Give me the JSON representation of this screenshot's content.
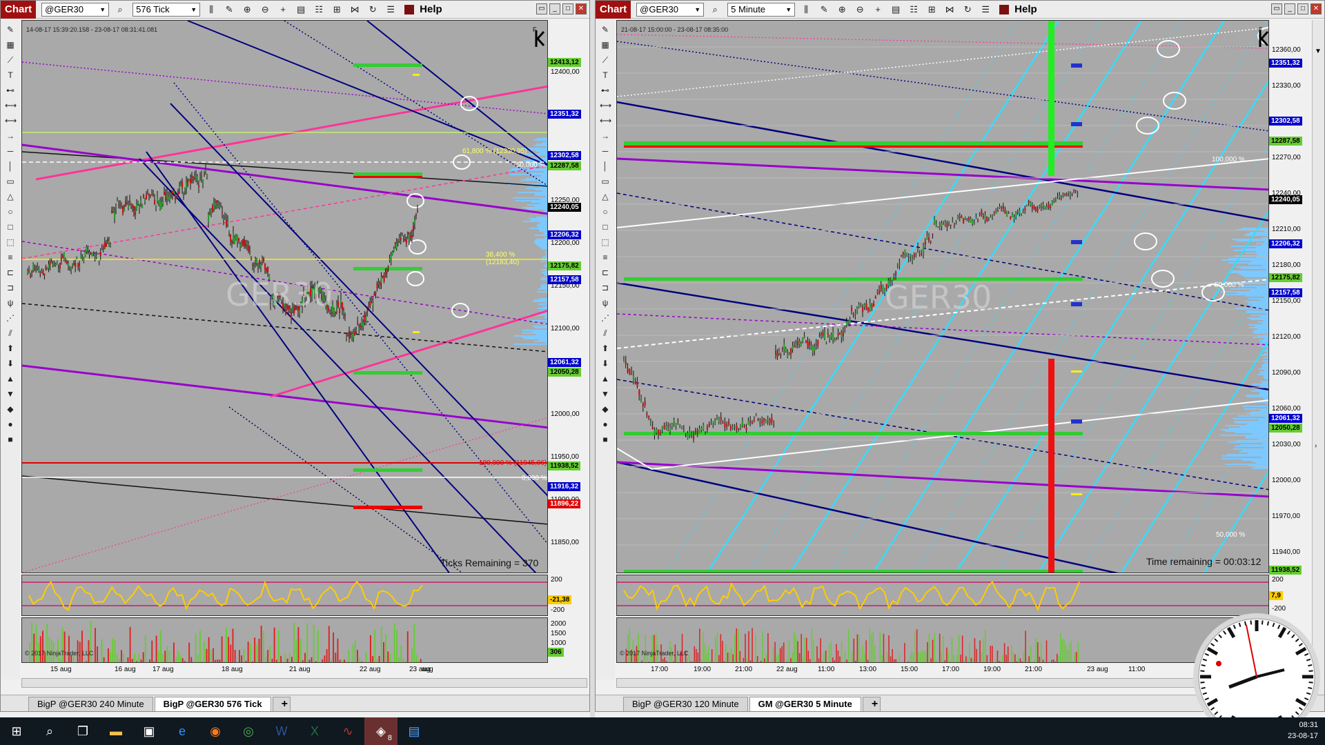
{
  "colors": {
    "chart_bg": "#a9a9a9",
    "accent_red": "#a01010",
    "price_label_blue": "#0000cc",
    "price_label_green": "#66cc33",
    "price_label_red": "#dd0000",
    "current_price_black": "#000000",
    "line_magenta": "#ff3399",
    "line_purple": "#9900cc",
    "line_navy": "#000080",
    "line_cyan": "#33ddff",
    "oscillator_yellow": "#ffcc00",
    "volume_green": "#66cc33",
    "volume_red": "#dd2222"
  },
  "left": {
    "toolbar": {
      "chart_label": "Chart",
      "instrument": "@GER30",
      "interval": "576 Tick",
      "help": "Help"
    },
    "info_text": "14-08-17 15:39:20.158 - 23-08-17 08:31:41.081",
    "watermark": "GER30",
    "ticks_remaining": "Ticks Remaining = 370",
    "copyright": "© 2017 NinjaTrader, LLC",
    "x_labels": [
      "15 aug",
      "16 aug",
      "17 aug",
      "18 aug",
      "21 aug",
      "22 aug",
      "23 aug",
      "aug"
    ],
    "axis_ticks": [
      "12400,00",
      "12350,00",
      "12300,00",
      "12250,00",
      "12200,00",
      "12150,00",
      "12100,00",
      "12050,00",
      "12000,00",
      "11950,00",
      "11900,00",
      "11850,00"
    ],
    "price_labels": [
      {
        "text": "12413,12",
        "kind": "green"
      },
      {
        "text": "12351,32",
        "kind": "blue"
      },
      {
        "text": "12302,58",
        "kind": "blue"
      },
      {
        "text": "12287,58",
        "kind": "green"
      },
      {
        "text": "12240,05",
        "kind": "black"
      },
      {
        "text": "12206,32",
        "kind": "blue"
      },
      {
        "text": "12175,82",
        "kind": "green"
      },
      {
        "text": "12157,58",
        "kind": "blue"
      },
      {
        "text": "12061,32",
        "kind": "blue"
      },
      {
        "text": "12050,28",
        "kind": "green"
      },
      {
        "text": "11938,52",
        "kind": "green"
      },
      {
        "text": "11916,32",
        "kind": "blue"
      },
      {
        "text": "11896,22",
        "kind": "red"
      }
    ],
    "fib_labels": [
      "61,800 % (12330,95)",
      "38,400 % (12183,40)",
      "100,000 % (11945,06)",
      "0,000 %",
      "50,000 %"
    ],
    "osc": {
      "ticks": [
        "200",
        "-200"
      ],
      "value": "-21,38"
    },
    "vol": {
      "ticks": [
        "2000",
        "1500",
        "1000",
        "500"
      ],
      "value": "306"
    },
    "tabs": [
      {
        "label": "BigP @GER30 240 Minute",
        "active": false
      },
      {
        "label": "BigP @GER30 576 Tick",
        "active": true
      }
    ],
    "tab_add": "+"
  },
  "right": {
    "toolbar": {
      "chart_label": "Chart",
      "instrument": "@GER30",
      "interval": "5 Minute",
      "help": "Help"
    },
    "info_text": "21-08-17 15:00:00 - 23-08-17 08:35:00",
    "watermark": "GER30",
    "time_remaining": "Time remaining = 00:03:12",
    "copyright": "© 2017 NinjaTrader, LLC",
    "x_labels": [
      "17:00",
      "19:00",
      "21:00",
      "22 aug",
      "11:00",
      "13:00",
      "15:00",
      "17:00",
      "19:00",
      "21:00",
      "23 aug",
      "11:00"
    ],
    "axis_ticks": [
      "12360,00",
      "12330,00",
      "12300,00",
      "12270,00",
      "12240,00",
      "12210,00",
      "12180,00",
      "12150,00",
      "12120,00",
      "12090,00",
      "12060,00",
      "12030,00",
      "12000,00",
      "11970,00",
      "11940,00"
    ],
    "price_labels": [
      {
        "text": "12351,32",
        "kind": "blue"
      },
      {
        "text": "12302,58",
        "kind": "blue"
      },
      {
        "text": "12287,58",
        "kind": "green"
      },
      {
        "text": "12240,05",
        "kind": "black"
      },
      {
        "text": "12206,32",
        "kind": "blue"
      },
      {
        "text": "12175,82",
        "kind": "green"
      },
      {
        "text": "12157,58",
        "kind": "blue"
      },
      {
        "text": "12061,32",
        "kind": "blue"
      },
      {
        "text": "12050,28",
        "kind": "green"
      },
      {
        "text": "11938,52",
        "kind": "green"
      }
    ],
    "fib_labels": [
      "100,000 %",
      "50,000 %",
      "50,000 %"
    ],
    "osc": {
      "ticks": [
        "200",
        "-200"
      ],
      "value": "7,9"
    },
    "tabs": [
      {
        "label": "BigP @GER30 120 Minute",
        "active": false
      },
      {
        "label": "GM @GER30 5 Minute",
        "active": true
      }
    ],
    "tab_add": "+"
  },
  "taskbar": {
    "apps": [
      "start-icon",
      "search-icon",
      "task-view-icon",
      "file-explorer-icon",
      "app-icon",
      "edge-icon",
      "firefox-icon",
      "chrome-icon",
      "word-icon",
      "excel-icon",
      "app-icon",
      "ninjatrader-icon",
      "app-icon"
    ],
    "badge": "8",
    "time": "08:31",
    "date": "23-08-17"
  }
}
